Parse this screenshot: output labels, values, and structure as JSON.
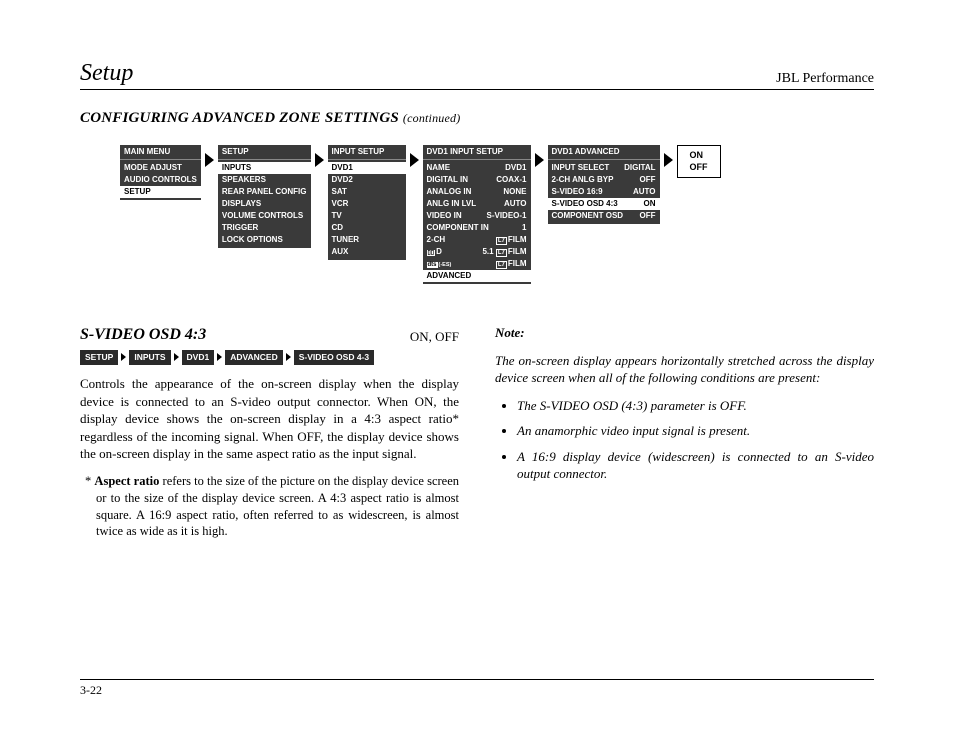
{
  "header": {
    "left": "Setup",
    "right": "JBL Performance"
  },
  "section": {
    "title": "CONFIGURING ADVANCED ZONE SETTINGS",
    "cont": "(continued)"
  },
  "flow": {
    "m1": {
      "title": "MAIN MENU",
      "items": [
        "MODE ADJUST",
        "AUDIO CONTROLS",
        "SETUP"
      ],
      "sel": 2
    },
    "m2": {
      "title": "SETUP",
      "items": [
        "INPUTS",
        "SPEAKERS",
        "REAR PANEL CONFIG",
        "DISPLAYS",
        "VOLUME CONTROLS",
        "TRIGGER",
        "LOCK OPTIONS"
      ],
      "sel": 0
    },
    "m3": {
      "title": "INPUT SETUP",
      "items": [
        "DVD1",
        "DVD2",
        "SAT",
        "VCR",
        "TV",
        "CD",
        "TUNER",
        "AUX"
      ],
      "sel": 0
    },
    "m4": {
      "title": "DVD1 INPUT SETUP",
      "rows": [
        {
          "k": "NAME",
          "v": "DVD1"
        },
        {
          "k": "DIGITAL IN",
          "v": "COAX-1"
        },
        {
          "k": "ANALOG IN",
          "v": "NONE"
        },
        {
          "k": "ANLG IN LVL",
          "v": "AUTO"
        },
        {
          "k": "VIDEO IN",
          "v": "S-VIDEO-1"
        },
        {
          "k": "COMPONENT IN",
          "v": "1"
        }
      ],
      "ch2_label": "2-CH",
      "ch2_value": "FILM",
      "dd_label": "D",
      "dd_mid": "5.1",
      "dd_value": "FILM",
      "dts_label": "dts(-ES)",
      "dts_value": "FILM",
      "advanced": "ADVANCED"
    },
    "m5": {
      "title": "DVD1 ADVANCED",
      "rows": [
        {
          "k": "INPUT SELECT",
          "v": "DIGITAL"
        },
        {
          "k": "2-CH ANLG BYP",
          "v": "OFF"
        },
        {
          "k": "S-VIDEO 16:9",
          "v": "AUTO"
        },
        {
          "k": "S-VIDEO OSD 4:3",
          "v": "ON"
        },
        {
          "k": "COMPONENT OSD",
          "v": "OFF"
        }
      ],
      "sel": 3
    },
    "opts": [
      "ON",
      "OFF"
    ]
  },
  "crumbs": [
    "SETUP",
    "INPUTS",
    "DVD1",
    "ADVANCED",
    "S-VIDEO OSD 4-3"
  ],
  "param": {
    "name": "S-VIDEO OSD 4:3",
    "opts": "ON, OFF"
  },
  "body": {
    "p1": "Controls the appearance of the on-screen display when the display device is connected to an S-video output connector. When ON, the display device shows the on-screen display in a 4:3 aspect ratio* regardless of the incoming signal. When OFF, the display device shows the on-screen display in the same aspect ratio as the input signal.",
    "fn_label": "* ",
    "fn_bold": "Aspect ratio",
    "fn_rest": " refers to the size of the picture on the display device screen or to the size of the display device screen. A 4:3 aspect ratio is almost square. A 16:9 aspect ratio, often referred to as widescreen, is almost twice as wide as it is high."
  },
  "note": {
    "head": "Note:",
    "intro": "The on-screen display appears horizontally stretched across the display device screen when all of the following conditions are present:",
    "items": [
      "The S-VIDEO OSD (4:3) parameter is OFF.",
      "An anamorphic video input signal is present.",
      "A 16:9 display device (widescreen) is connected to an S-video output connector."
    ]
  },
  "page_no": "3-22"
}
